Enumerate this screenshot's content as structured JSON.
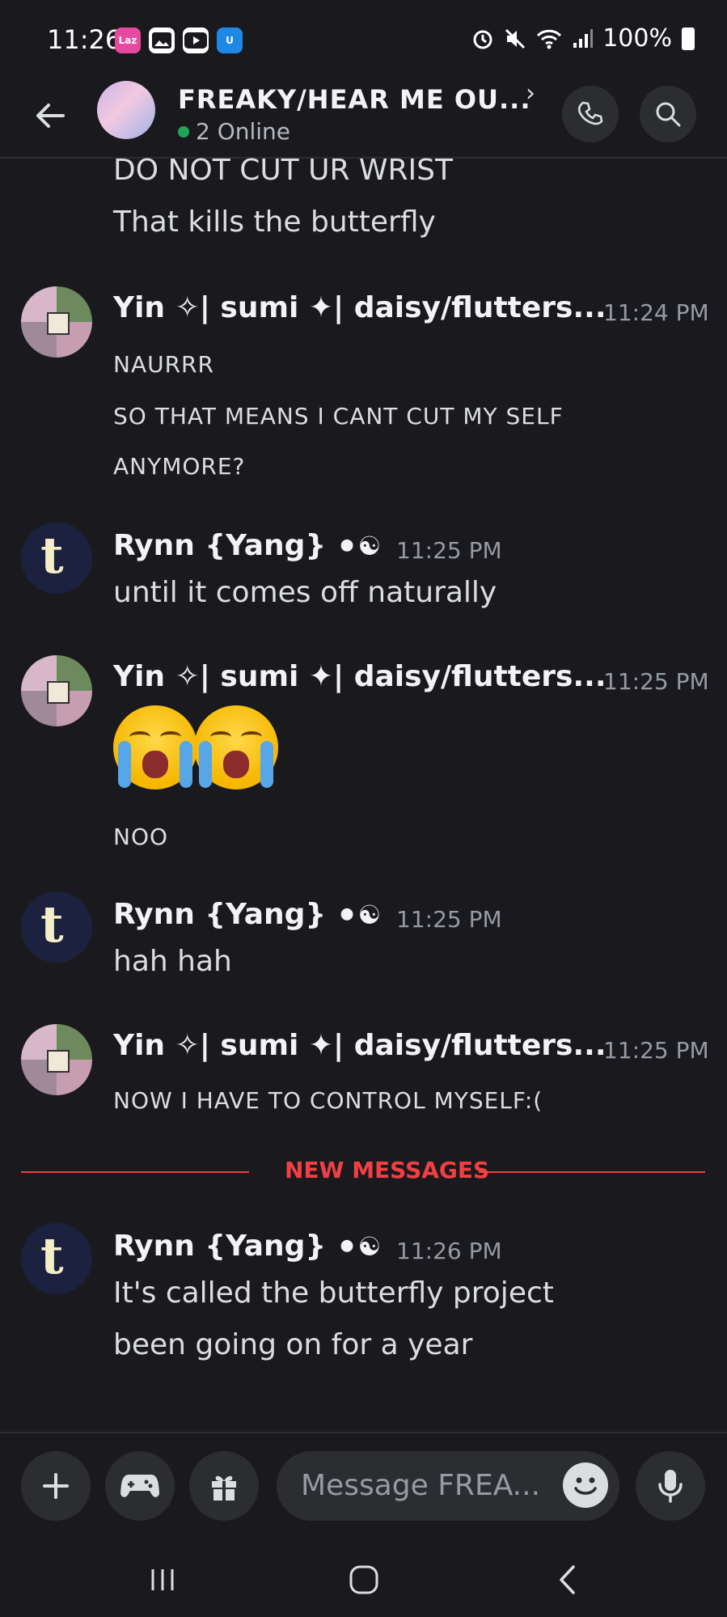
{
  "status_bar": {
    "time": "11:26",
    "battery": "100%"
  },
  "header": {
    "title": "FREAKY/HEAR ME OU...",
    "chevron": "›",
    "online_text": "2 Online"
  },
  "messages": [
    {
      "type": "continuation",
      "lines": [
        "DO NOT CUT UR WRIST",
        "That kills the butterfly"
      ]
    },
    {
      "type": "message",
      "author": "Yin ✧| sumi ✦| daisy/flutters...",
      "time": "11:24 PM",
      "avatar": "yin",
      "lines": [
        "NAURRR",
        "SO THAT MEANS I CANT CUT MY SELF",
        "ANYMORE?"
      ]
    },
    {
      "type": "message",
      "author": "Rynn {Yang}",
      "time": "11:25 PM",
      "avatar": "rynn",
      "lines": [
        "until it comes off naturally"
      ]
    },
    {
      "type": "message",
      "author": "Yin ✧| sumi ✦| daisy/flutters...",
      "time": "11:25 PM",
      "avatar": "yin",
      "emojis": [
        "loudly-crying-face",
        "loudly-crying-face"
      ],
      "lines": [
        "NOO"
      ]
    },
    {
      "type": "message",
      "author": "Rynn {Yang}",
      "time": "11:25 PM",
      "avatar": "rynn",
      "lines": [
        "hah hah"
      ]
    },
    {
      "type": "message",
      "author": "Yin ✧| sumi ✦| daisy/flutters...",
      "time": "11:25 PM",
      "avatar": "yin",
      "lines": [
        "NOW I HAVE TO CONTROL MYSELF:("
      ]
    },
    {
      "type": "message",
      "author": "Rynn {Yang}",
      "time": "11:26 PM",
      "avatar": "rynn",
      "lines": [
        "It's called the butterfly project",
        "been going on for a year"
      ]
    }
  ],
  "new_messages_label": "NEW MESSAGES",
  "rynn_badges": "⚫☯",
  "composer": {
    "placeholder": "Message FREA..."
  },
  "colors": {
    "background": "#1a1a1e",
    "surface": "#2b2d31",
    "online_green": "#23a559",
    "new_messages_red": "#f23f43",
    "timestamp": "#949ba4"
  }
}
